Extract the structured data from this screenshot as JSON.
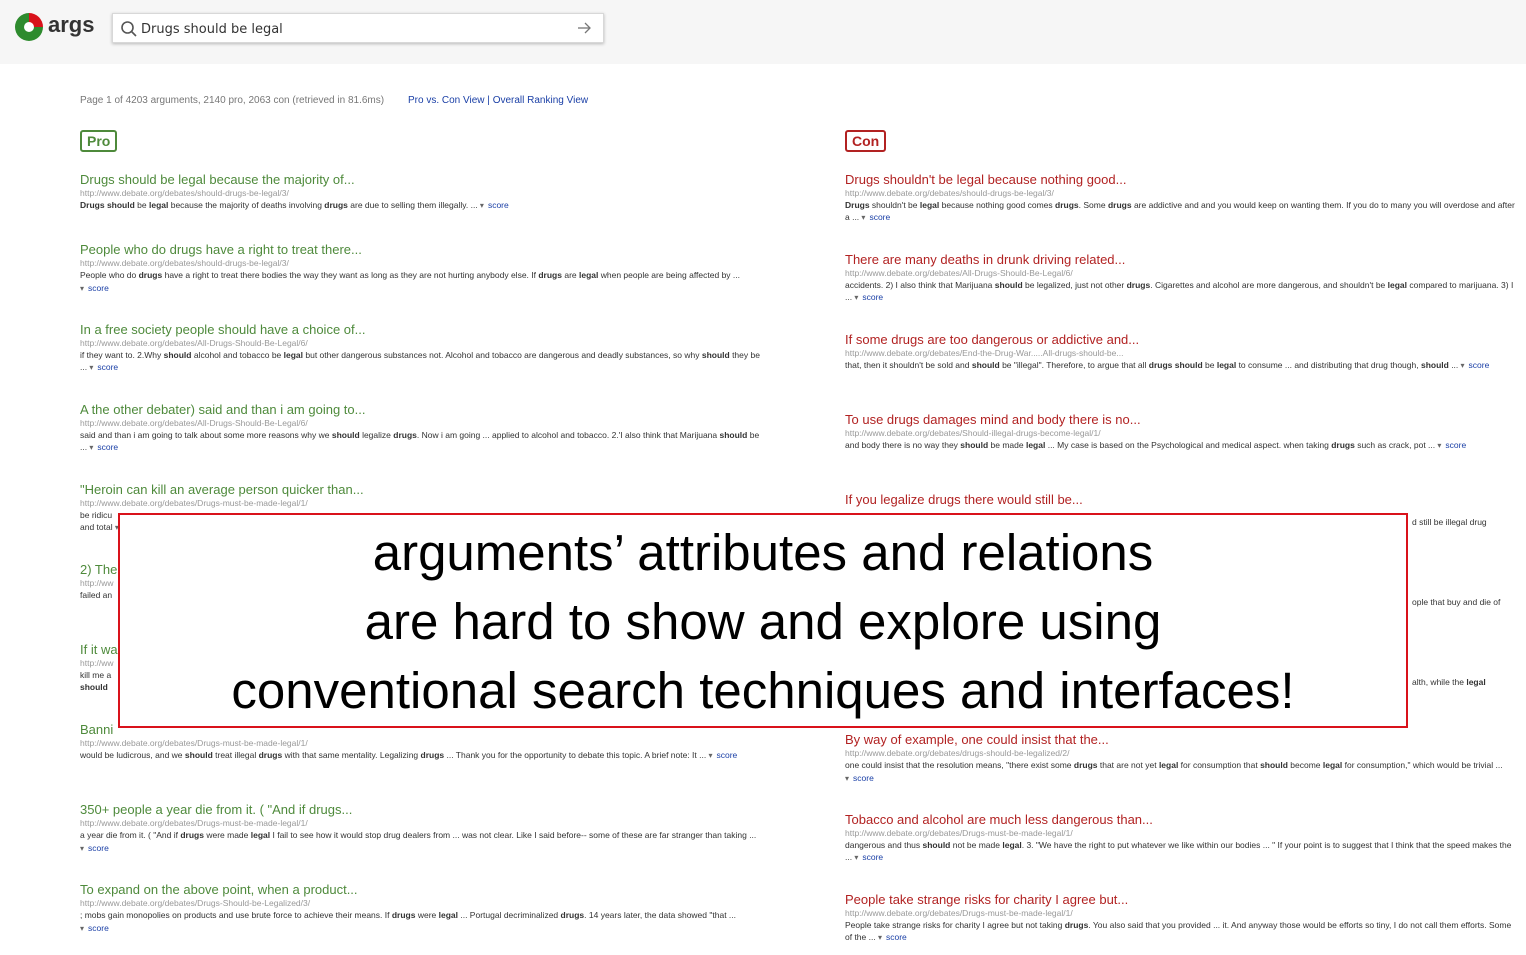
{
  "header": {
    "logo_text": "args",
    "search_value": "Drugs should be legal"
  },
  "stats": {
    "text": "Page 1 of 4203 arguments, 2140 pro, 2063 con (retrieved in 81.6ms)",
    "link_pro_con": "Pro vs. Con View",
    "separator": "|",
    "link_overall": "Overall Ranking View"
  },
  "columns": {
    "pro_label": "Pro",
    "con_label": "Con"
  },
  "score_label": "score",
  "pro_results": [
    {
      "title": "Drugs should be legal because the majority of...",
      "url": "http://www.debate.org/debates/should-drugs-be-legal/3/",
      "snippet": "<b>Drugs</b> <b>should</b> be <b>legal</b> because the majority of deaths involving <b>drugs</b> are due to selling them illegally. ..."
    },
    {
      "title": "People who do drugs have a right to treat there...",
      "url": "http://www.debate.org/debates/should-drugs-be-legal/3/",
      "snippet": "People who do <b>drugs</b> have a right to treat there bodies the way they want as long as they are not hurting anybody else. If <b>drugs</b> are <b>legal</b> when people are being affected by ..."
    },
    {
      "title": "In a free society people should have a choice of...",
      "url": "http://www.debate.org/debates/All-Drugs-Should-Be-Legal/6/",
      "snippet": "if they want to. 2.Why <b>should</b> alcohol and tobacco be <b>legal</b> but other dangerous substances not. Alcohol and tobacco are dangerous and deadly substances, so why <b>should</b> they be ..."
    },
    {
      "title": "A the other debater) said and than i am going to...",
      "url": "http://www.debate.org/debates/All-Drugs-Should-Be-Legal/6/",
      "snippet": "said and than i am going to talk about some more reasons why we <b>should</b> legalize <b>drugs</b>. Now i am going ... applied to alcohol and tobacco. 2.'I also think that Marijuana <b>should</b> be ..."
    },
    {
      "title": "\"Heroin can kill an average person quicker than...",
      "url": "http://www.debate.org/debates/Drugs-must-be-made-legal/1/",
      "snippet": "be ridicu<br>and total"
    },
    {
      "title": "2) The",
      "url": "http://ww",
      "snippet": "failed an"
    },
    {
      "title": "If it wa",
      "url": "http://ww",
      "snippet": "kill me a<br><b>should</b>"
    },
    {
      "title": "Banni",
      "url": "http://www.debate.org/debates/Drugs-must-be-made-legal/1/",
      "snippet": "would be ludicrous, and we <b>should</b> treat illegal <b>drugs</b> with that same mentality. Legalizing <b>drugs</b> ... Thank you for the opportunity to debate this topic. A brief note: It ..."
    },
    {
      "title": "350+ people a year die from it. ( \"And if drugs...",
      "url": "http://www.debate.org/debates/Drugs-must-be-made-legal/1/",
      "snippet": "a year die from it. ( \"And if <b>drugs</b> were made <b>legal</b> I fail to see how it would stop drug dealers from ... was not clear. Like I said before-- some of these are far stranger than taking ..."
    },
    {
      "title": "To expand on the above point, when a product...",
      "url": "http://www.debate.org/debates/Drugs-Should-be-Legalized/3/",
      "snippet": "; mobs gain monopolies on products and use brute force to achieve their means. If <b>drugs</b> were <b>legal</b> ... Portugal decriminalized <b>drugs</b>. 14 years later, the data showed \"that ..."
    }
  ],
  "con_results": [
    {
      "title": "Drugs shouldn't be legal because nothing good...",
      "url": "http://www.debate.org/debates/should-drugs-be-legal/3/",
      "snippet": "<b>Drugs</b> shouldn't be <b>legal</b> because nothing good comes <b>drugs</b>. Some <b>drugs</b> are addictive and and you would keep on wanting them. If you do to many you will overdose and after a ..."
    },
    {
      "title": "There are many deaths in drunk driving related...",
      "url": "http://www.debate.org/debates/All-Drugs-Should-Be-Legal/6/",
      "snippet": "accidents. 2) I also think that Marijuana <b>should</b> be legalized, just not other <b>drugs</b>. Cigarettes and alcohol are more dangerous, and shouldn't be <b>legal</b> compared to marijuana. 3) I ..."
    },
    {
      "title": "If some drugs are too dangerous or addictive and...",
      "url": "http://www.debate.org/debates/End-the-Drug-War.....All-drugs-should-be...",
      "snippet": "that, then it shouldn't be sold and <b>should</b> be \"illegal\". Therefore, to argue that all <b>drugs</b> <b>should</b> be <b>legal</b> to consume ... and distributing that drug though, <b>should</b> ..."
    },
    {
      "title": "To use drugs damages mind and body there is no...",
      "url": "http://www.debate.org/debates/Should-illegal-drugs-become-legal/1/",
      "snippet": "and body there is no way they <b>should</b> be made <b>legal</b> ... My case is based on the Psychological and medical aspect. when taking <b>drugs</b> such as crack, pot ..."
    },
    {
      "title": "If you legalize drugs there would still be...",
      "url": "",
      "snippet": ""
    },
    {
      "title": "",
      "url": "",
      "snippet": "d still be illegal drug"
    },
    {
      "title": "",
      "url": "",
      "snippet": "ople that buy and die of"
    },
    {
      "title": "",
      "url": "",
      "snippet": "alth, while the <b>legal</b>"
    },
    {
      "title": "By way of example, one could insist that the...",
      "url": "http://www.debate.org/debates/drugs-should-be-legalized/2/",
      "snippet": "one could insist that the resolution means, \"there exist some <b>drugs</b> that are not yet <b>legal</b> for consumption that <b>should</b> become <b>legal</b> for consumption,\" which would be trivial ..."
    },
    {
      "title": "Tobacco and alcohol are much less dangerous than...",
      "url": "http://www.debate.org/debates/Drugs-must-be-made-legal/1/",
      "snippet": "dangerous and thus <b>should</b> not be made <b>legal</b>. 3. \"We have the right to put whatever we like within our bodies ... \" If your point is to suggest that I think that the speed makes the ..."
    },
    {
      "title": "People take strange risks for charity I agree but...",
      "url": "http://www.debate.org/debates/Drugs-must-be-made-legal/1/",
      "snippet": "People take strange risks for charity I agree but not taking <b>drugs</b>. You also said that you provided ... it. And anyway those would be efforts so tiny, I do not call them efforts. Some of the ..."
    }
  ],
  "overlay": {
    "line1": "arguments’ attributes and relations",
    "line2": "are hard to show and explore using",
    "line3": "conventional search techniques and interfaces!"
  }
}
